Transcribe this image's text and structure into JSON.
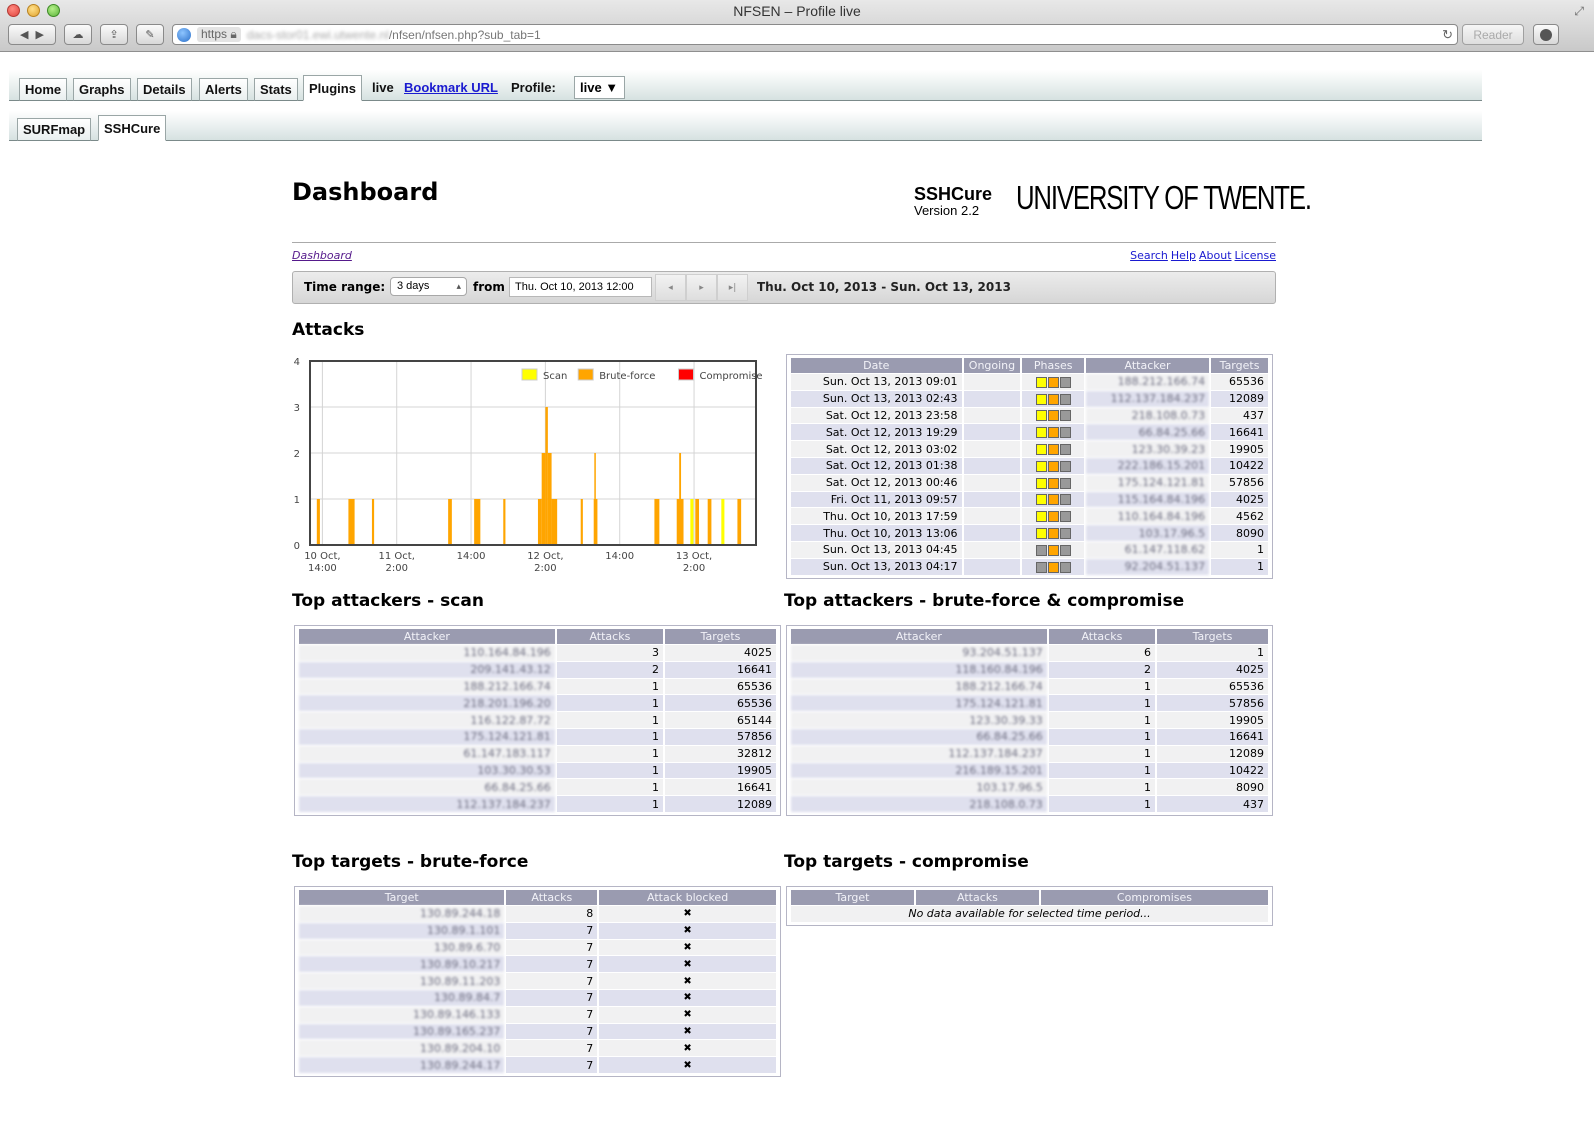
{
  "browser": {
    "window_title": "NFSEN – Profile live",
    "url_scheme": "https",
    "url_host_blurred": "dacs-stor01.ewi.utwente.nl",
    "url_path": "/nfsen/nfsen.php?sub_tab=1",
    "reader_label": "Reader"
  },
  "nav": {
    "tabs": [
      "Home",
      "Graphs",
      "Details",
      "Alerts",
      "Stats",
      "Plugins"
    ],
    "active_tab": "Plugins",
    "live_label": "live",
    "bookmark_label": "Bookmark URL",
    "profile_label": "Profile:",
    "profile_value": "live ▼"
  },
  "subnav": {
    "tabs": [
      "SURFmap",
      "SSHCure"
    ],
    "active_tab": "SSHCure"
  },
  "header": {
    "title": "Dashboard",
    "brand_name": "SSHCure",
    "brand_version": "Version 2.2",
    "university": "UNIVERSITY OF TWENTE."
  },
  "breadcrumb": "Dashboard",
  "toplinks": [
    "Search",
    "Help",
    "About",
    "License"
  ],
  "timerange": {
    "label": "Time range:",
    "select_value": "3 days",
    "from_label": "from",
    "from_value": "Thu. Oct 10, 2013 12:00",
    "prev_icon": "◂",
    "next_icon": "▸",
    "last_icon": "▸|",
    "range_text": "Thu. Oct 10, 2013 - Sun. Oct 13, 2013"
  },
  "sections": {
    "attacks": "Attacks",
    "top_scan": "Top attackers - scan",
    "top_bf": "Top attackers - brute-force & compromise",
    "targets_bf": "Top targets - brute-force",
    "targets_comp": "Top targets - compromise"
  },
  "colors": {
    "scan": "#ffff00",
    "bruteforce": "#ffa500",
    "compromise": "#ff0000",
    "phase_inactive": "#999999",
    "table_header": "#9a9bb0"
  },
  "chart_data": {
    "type": "bar",
    "title": "Attacks",
    "xlabel": "",
    "ylabel": "",
    "x_unit": "hours since Thu 10 Oct 2013 12:00",
    "xlim": [
      0,
      72
    ],
    "ylim": [
      0,
      4
    ],
    "yticks": [
      0,
      1,
      2,
      3,
      4
    ],
    "xticks": [
      {
        "at": 2,
        "label": [
          "10 Oct,",
          "14:00"
        ]
      },
      {
        "at": 14,
        "label": [
          "11 Oct,",
          "2:00"
        ]
      },
      {
        "at": 26,
        "label": [
          "14:00"
        ]
      },
      {
        "at": 38,
        "label": [
          "12 Oct,",
          "2:00"
        ]
      },
      {
        "at": 50,
        "label": [
          "14:00"
        ]
      },
      {
        "at": 62,
        "label": [
          "13 Oct,",
          "2:00"
        ]
      }
    ],
    "grid": true,
    "legend": {
      "position": "top-right",
      "entries": [
        "Scan",
        "Brute-force",
        "Compromise"
      ]
    },
    "series": [
      {
        "name": "Brute-force",
        "color": "#ffa500",
        "bars": [
          {
            "x": 1.1,
            "w": 0.5,
            "value": 1
          },
          {
            "x": 6.2,
            "w": 1.0,
            "value": 1
          },
          {
            "x": 10.0,
            "w": 0.35,
            "value": 1
          },
          {
            "x": 22.3,
            "w": 0.6,
            "value": 1
          },
          {
            "x": 26.5,
            "w": 1.0,
            "value": 1
          },
          {
            "x": 31.2,
            "w": 0.35,
            "value": 1
          },
          {
            "x": 36.8,
            "w": 0.6,
            "value": 1
          },
          {
            "x": 37.4,
            "w": 0.6,
            "value": 2
          },
          {
            "x": 38.0,
            "w": 0.4,
            "value": 3
          },
          {
            "x": 38.4,
            "w": 0.6,
            "value": 2
          },
          {
            "x": 39.0,
            "w": 0.9,
            "value": 1
          },
          {
            "x": 43.7,
            "w": 0.35,
            "value": 1
          },
          {
            "x": 45.9,
            "w": 0.2,
            "value": 2
          },
          {
            "x": 45.8,
            "w": 0.6,
            "value": 1
          },
          {
            "x": 55.6,
            "w": 0.8,
            "value": 1
          },
          {
            "x": 59.6,
            "w": 0.3,
            "value": 2
          },
          {
            "x": 59.2,
            "w": 1.1,
            "value": 1
          },
          {
            "x": 62.2,
            "w": 0.6,
            "value": 1
          },
          {
            "x": 64.2,
            "w": 0.6,
            "value": 1
          },
          {
            "x": 69.0,
            "w": 0.6,
            "value": 1
          }
        ]
      },
      {
        "name": "Scan",
        "color": "#ffff00",
        "bars": [
          {
            "x": 61.4,
            "w": 0.5,
            "value": 1
          },
          {
            "x": 66.4,
            "w": 0.5,
            "value": 1
          }
        ]
      },
      {
        "name": "Compromise",
        "color": "#ff0000",
        "bars": []
      }
    ]
  },
  "attacks_table": {
    "columns": [
      "Date",
      "Ongoing",
      "Phases",
      "Attacker",
      "Targets"
    ],
    "rows": [
      {
        "date": "Sun. Oct 13, 2013 09:01",
        "ongoing": "",
        "phases": [
          "scan",
          "bruteforce",
          "inactive"
        ],
        "attacker": "188.212.166.74",
        "targets": "65536"
      },
      {
        "date": "Sun. Oct 13, 2013 02:43",
        "ongoing": "",
        "phases": [
          "scan",
          "bruteforce",
          "inactive"
        ],
        "attacker": "112.137.184.237",
        "targets": "12089"
      },
      {
        "date": "Sat. Oct 12, 2013 23:58",
        "ongoing": "",
        "phases": [
          "scan",
          "bruteforce",
          "inactive"
        ],
        "attacker": "218.108.0.73",
        "targets": "437"
      },
      {
        "date": "Sat. Oct 12, 2013 19:29",
        "ongoing": "",
        "phases": [
          "scan",
          "bruteforce",
          "inactive"
        ],
        "attacker": "66.84.25.66",
        "targets": "16641"
      },
      {
        "date": "Sat. Oct 12, 2013 03:02",
        "ongoing": "",
        "phases": [
          "scan",
          "bruteforce",
          "inactive"
        ],
        "attacker": "123.30.39.23",
        "targets": "19905"
      },
      {
        "date": "Sat. Oct 12, 2013 01:38",
        "ongoing": "",
        "phases": [
          "scan",
          "bruteforce",
          "inactive"
        ],
        "attacker": "222.186.15.201",
        "targets": "10422"
      },
      {
        "date": "Sat. Oct 12, 2013 00:46",
        "ongoing": "",
        "phases": [
          "scan",
          "bruteforce",
          "inactive"
        ],
        "attacker": "175.124.121.81",
        "targets": "57856"
      },
      {
        "date": "Fri. Oct 11, 2013 09:57",
        "ongoing": "",
        "phases": [
          "scan",
          "bruteforce",
          "inactive"
        ],
        "attacker": "115.164.84.196",
        "targets": "4025"
      },
      {
        "date": "Thu. Oct 10, 2013 17:59",
        "ongoing": "",
        "phases": [
          "scan",
          "bruteforce",
          "inactive"
        ],
        "attacker": "110.164.84.196",
        "targets": "4562"
      },
      {
        "date": "Thu. Oct 10, 2013 13:06",
        "ongoing": "",
        "phases": [
          "scan",
          "bruteforce",
          "inactive"
        ],
        "attacker": "103.17.96.5",
        "targets": "8090"
      },
      {
        "date": "Sun. Oct 13, 2013 04:45",
        "ongoing": "",
        "phases": [
          "inactive",
          "bruteforce",
          "inactive"
        ],
        "attacker": "61.147.118.62",
        "targets": "1"
      },
      {
        "date": "Sun. Oct 13, 2013 04:17",
        "ongoing": "",
        "phases": [
          "inactive",
          "bruteforce",
          "inactive"
        ],
        "attacker": "92.204.51.137",
        "targets": "1"
      }
    ]
  },
  "top_scan_table": {
    "columns": [
      "Attacker",
      "Attacks",
      "Targets"
    ],
    "rows": [
      {
        "attacker": "110.164.84.196",
        "attacks": "3",
        "targets": "4025"
      },
      {
        "attacker": "209.141.43.12",
        "attacks": "2",
        "targets": "16641"
      },
      {
        "attacker": "188.212.166.74",
        "attacks": "1",
        "targets": "65536"
      },
      {
        "attacker": "218.201.196.20",
        "attacks": "1",
        "targets": "65536"
      },
      {
        "attacker": "116.122.87.72",
        "attacks": "1",
        "targets": "65144"
      },
      {
        "attacker": "175.124.121.81",
        "attacks": "1",
        "targets": "57856"
      },
      {
        "attacker": "61.147.183.117",
        "attacks": "1",
        "targets": "32812"
      },
      {
        "attacker": "103.30.30.53",
        "attacks": "1",
        "targets": "19905"
      },
      {
        "attacker": "66.84.25.66",
        "attacks": "1",
        "targets": "16641"
      },
      {
        "attacker": "112.137.184.237",
        "attacks": "1",
        "targets": "12089"
      }
    ]
  },
  "top_bf_table": {
    "columns": [
      "Attacker",
      "Attacks",
      "Targets"
    ],
    "rows": [
      {
        "attacker": "93.204.51.137",
        "attacks": "6",
        "targets": "1"
      },
      {
        "attacker": "118.160.84.196",
        "attacks": "2",
        "targets": "4025"
      },
      {
        "attacker": "188.212.166.74",
        "attacks": "1",
        "targets": "65536"
      },
      {
        "attacker": "175.124.121.81",
        "attacks": "1",
        "targets": "57856"
      },
      {
        "attacker": "123.30.39.33",
        "attacks": "1",
        "targets": "19905"
      },
      {
        "attacker": "66.84.25.66",
        "attacks": "1",
        "targets": "16641"
      },
      {
        "attacker": "112.137.184.237",
        "attacks": "1",
        "targets": "12089"
      },
      {
        "attacker": "216.189.15.201",
        "attacks": "1",
        "targets": "10422"
      },
      {
        "attacker": "103.17.96.5",
        "attacks": "1",
        "targets": "8090"
      },
      {
        "attacker": "218.108.0.73",
        "attacks": "1",
        "targets": "437"
      }
    ]
  },
  "targets_bf_table": {
    "columns": [
      "Target",
      "Attacks",
      "Attack blocked"
    ],
    "rows": [
      {
        "target": "130.89.244.18",
        "attacks": "8",
        "blocked": "✖"
      },
      {
        "target": "130.89.1.101",
        "attacks": "7",
        "blocked": "✖"
      },
      {
        "target": "130.89.6.70",
        "attacks": "7",
        "blocked": "✖"
      },
      {
        "target": "130.89.10.217",
        "attacks": "7",
        "blocked": "✖"
      },
      {
        "target": "130.89.11.203",
        "attacks": "7",
        "blocked": "✖"
      },
      {
        "target": "130.89.84.7",
        "attacks": "7",
        "blocked": "✖"
      },
      {
        "target": "130.89.146.133",
        "attacks": "7",
        "blocked": "✖"
      },
      {
        "target": "130.89.165.237",
        "attacks": "7",
        "blocked": "✖"
      },
      {
        "target": "130.89.204.10",
        "attacks": "7",
        "blocked": "✖"
      },
      {
        "target": "130.89.244.17",
        "attacks": "7",
        "blocked": "✖"
      }
    ]
  },
  "targets_comp_table": {
    "columns": [
      "Target",
      "Attacks",
      "Compromises"
    ],
    "empty_message": "No data available for selected time period..."
  }
}
